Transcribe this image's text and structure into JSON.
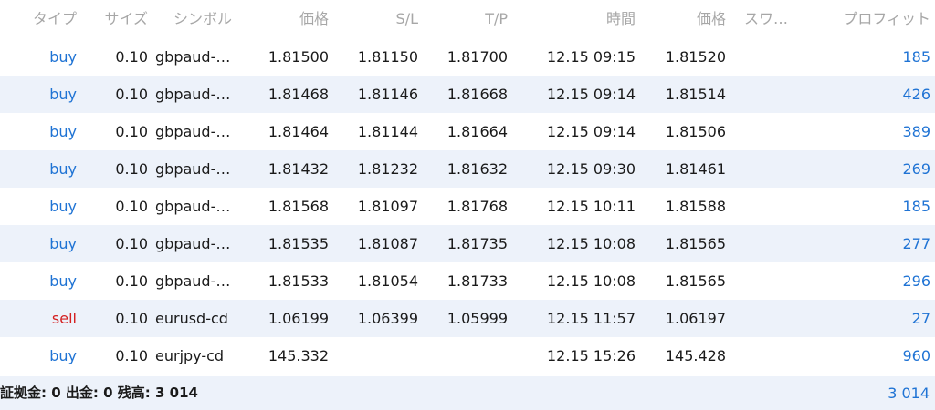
{
  "colors": {
    "buy": "#1f73d4",
    "sell": "#d42121",
    "header_text": "#a7a7a7",
    "alt_row_bg": "#edf2fa",
    "profit": "#1f73d4"
  },
  "header": {
    "type": "タイプ",
    "size": "サイズ",
    "symbol": "シンボル",
    "price": "価格",
    "sl": "S/L",
    "tp": "T/P",
    "time": "時間",
    "current_price": "価格",
    "swap": "スワ…",
    "profit": "プロフィット"
  },
  "rows": [
    {
      "type": "buy",
      "size": "0.10",
      "symbol": "gbpaud-…",
      "price": "1.81500",
      "sl": "1.81150",
      "tp": "1.81700",
      "time": "12.15 09:15",
      "current_price": "1.81520",
      "swap": "",
      "profit": "185"
    },
    {
      "type": "buy",
      "size": "0.10",
      "symbol": "gbpaud-…",
      "price": "1.81468",
      "sl": "1.81146",
      "tp": "1.81668",
      "time": "12.15 09:14",
      "current_price": "1.81514",
      "swap": "",
      "profit": "426"
    },
    {
      "type": "buy",
      "size": "0.10",
      "symbol": "gbpaud-…",
      "price": "1.81464",
      "sl": "1.81144",
      "tp": "1.81664",
      "time": "12.15 09:14",
      "current_price": "1.81506",
      "swap": "",
      "profit": "389"
    },
    {
      "type": "buy",
      "size": "0.10",
      "symbol": "gbpaud-…",
      "price": "1.81432",
      "sl": "1.81232",
      "tp": "1.81632",
      "time": "12.15 09:30",
      "current_price": "1.81461",
      "swap": "",
      "profit": "269"
    },
    {
      "type": "buy",
      "size": "0.10",
      "symbol": "gbpaud-…",
      "price": "1.81568",
      "sl": "1.81097",
      "tp": "1.81768",
      "time": "12.15 10:11",
      "current_price": "1.81588",
      "swap": "",
      "profit": "185"
    },
    {
      "type": "buy",
      "size": "0.10",
      "symbol": "gbpaud-…",
      "price": "1.81535",
      "sl": "1.81087",
      "tp": "1.81735",
      "time": "12.15 10:08",
      "current_price": "1.81565",
      "swap": "",
      "profit": "277"
    },
    {
      "type": "buy",
      "size": "0.10",
      "symbol": "gbpaud-…",
      "price": "1.81533",
      "sl": "1.81054",
      "tp": "1.81733",
      "time": "12.15 10:08",
      "current_price": "1.81565",
      "swap": "",
      "profit": "296"
    },
    {
      "type": "sell",
      "size": "0.10",
      "symbol": "eurusd-cd",
      "price": "1.06199",
      "sl": "1.06399",
      "tp": "1.05999",
      "time": "12.15 11:57",
      "current_price": "1.06197",
      "swap": "",
      "profit": "27"
    },
    {
      "type": "buy",
      "size": "0.10",
      "symbol": "eurjpy-cd",
      "price": "145.332",
      "sl": "",
      "tp": "",
      "time": "12.15 15:26",
      "current_price": "145.428",
      "swap": "",
      "profit": "960"
    }
  ],
  "footer": {
    "summary": "証拠金: 0 出金: 0 残高: 3 014",
    "total_profit": "3 014"
  }
}
